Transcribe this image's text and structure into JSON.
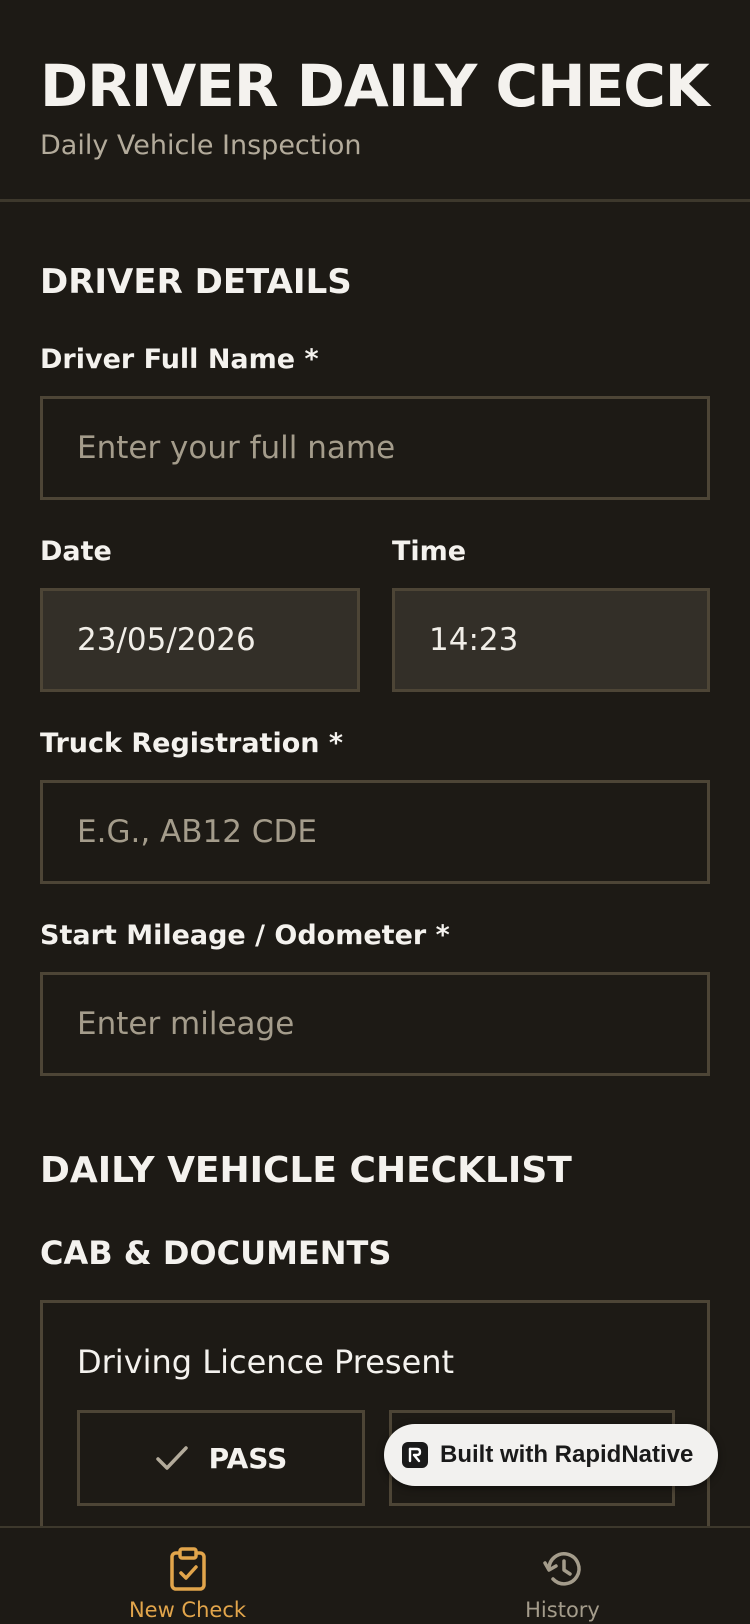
{
  "header": {
    "title": "DRIVER DAILY CHECK",
    "subtitle": "Daily Vehicle Inspection"
  },
  "driver_details": {
    "section_title": "DRIVER DETAILS",
    "full_name": {
      "label": "Driver Full Name *",
      "placeholder": "Enter your full name",
      "value": ""
    },
    "date": {
      "label": "Date",
      "value": "23/05/2026"
    },
    "time": {
      "label": "Time",
      "value": "14:23"
    },
    "truck_registration": {
      "label": "Truck Registration *",
      "placeholder": "E.G., AB12 CDE",
      "value": ""
    },
    "mileage": {
      "label": "Start Mileage / Odometer *",
      "placeholder": "Enter mileage",
      "value": ""
    }
  },
  "checklist": {
    "section_title": "DAILY VEHICLE CHECKLIST",
    "category": "CAB & DOCUMENTS",
    "items": [
      {
        "label": "Driving Licence Present",
        "pass_label": "PASS"
      }
    ]
  },
  "badge": {
    "text": "Built with RapidNative"
  },
  "bottom_nav": {
    "items": [
      {
        "label": "New Check",
        "icon": "clipboard-check-icon",
        "active": true
      },
      {
        "label": "History",
        "icon": "history-icon",
        "active": false
      }
    ]
  },
  "colors": {
    "background": "#1d1a15",
    "border": "#4d4536",
    "accent": "#e2a54b",
    "muted": "#b3ab9b"
  }
}
